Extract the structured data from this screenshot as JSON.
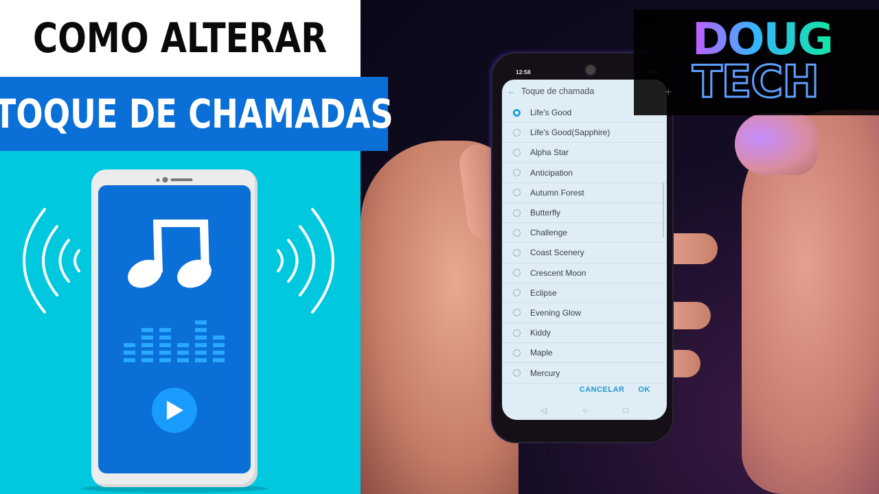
{
  "thumbnail": {
    "title_line1": "COMO ALTERAR",
    "title_line2": "TOQUE DE CHAMADAS",
    "colors": {
      "background": "#00c8de",
      "title_bg": "#ffffff",
      "subtitle_bg": "#0a6fd6",
      "illus_screen": "#0a6fd6"
    }
  },
  "logo": {
    "line1": "DOUG",
    "line2": "TECH"
  },
  "phone": {
    "status_bar": {
      "time": "12:58",
      "left_icons": "✓ 🛇",
      "battery": "99%"
    },
    "dialog": {
      "title": "Toque de chamada",
      "selected": "Life's Good",
      "ringtones": [
        {
          "label": "Life's Good",
          "checked": true
        },
        {
          "label": "Life's Good(Sapphire)",
          "checked": false
        },
        {
          "label": "Alpha Star",
          "checked": false
        },
        {
          "label": "Anticipation",
          "checked": false
        },
        {
          "label": "Autumn Forest",
          "checked": false
        },
        {
          "label": "Butterfly",
          "checked": false
        },
        {
          "label": "Challenge",
          "checked": false
        },
        {
          "label": "Coast Scenery",
          "checked": false
        },
        {
          "label": "Crescent Moon",
          "checked": false
        },
        {
          "label": "Eclipse",
          "checked": false
        },
        {
          "label": "Evening Glow",
          "checked": false
        },
        {
          "label": "Kiddy",
          "checked": false
        },
        {
          "label": "Maple",
          "checked": false
        },
        {
          "label": "Mercury",
          "checked": false
        }
      ],
      "cancel_label": "CANCELAR",
      "ok_label": "OK",
      "accent": "#1f9fdd"
    },
    "nav": {
      "back": "◁",
      "home": "○",
      "recents": "□"
    }
  }
}
